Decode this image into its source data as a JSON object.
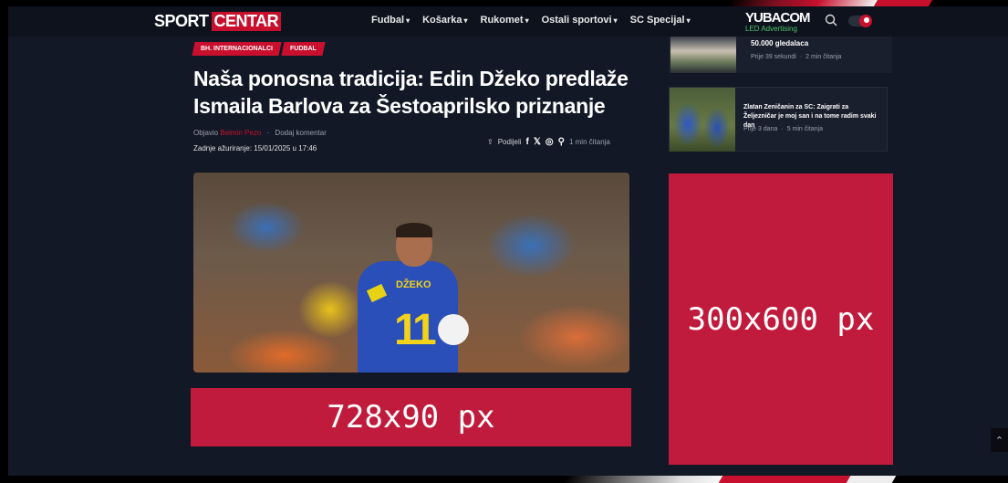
{
  "header": {
    "logo_left": "SPORT",
    "logo_right": "CENTAR",
    "nav": [
      {
        "label": "Fudbal"
      },
      {
        "label": "Košarka"
      },
      {
        "label": "Rukomet"
      },
      {
        "label": "Ostali sportovi"
      },
      {
        "label": "SC Specijal"
      }
    ],
    "sponsor_name": "YUBACOM",
    "sponsor_sub": "LED Advertising"
  },
  "article": {
    "tags": [
      "BH. INTERNACIONALCI",
      "FUDBAL"
    ],
    "title": "Naša ponosna tradicija: Edin Džeko predlaže Ismaila Barlova za Šestoaprilsko priznanje",
    "published_by_label": "Objavio",
    "author": "Belmin Pezo",
    "add_comment": "Dodaj komentar",
    "updated": "Zadnje ažuriranje: 15/01/2025 u 17:46",
    "share_label": "Podijeli",
    "read_time": "1 min čitanja",
    "hero_name": "DŽEKO",
    "hero_number": "11"
  },
  "ads": {
    "leaderboard": "728x90 px",
    "sidebar": "300x600 px"
  },
  "sidebar": {
    "cards": [
      {
        "title": "50.000 gledalaca",
        "time": "Prije 39 sekundi",
        "read": "2 min čitanja"
      },
      {
        "title": "Zlatan Zeničanin za SC: Zaigrati za Željezničar je moj san i na tome radim svaki dan",
        "time": "Prije 3 dana",
        "read": "5 min čitanja"
      }
    ]
  },
  "colors": {
    "accent": "#c8102e",
    "background": "#131826",
    "ad": "#c01b3c"
  }
}
